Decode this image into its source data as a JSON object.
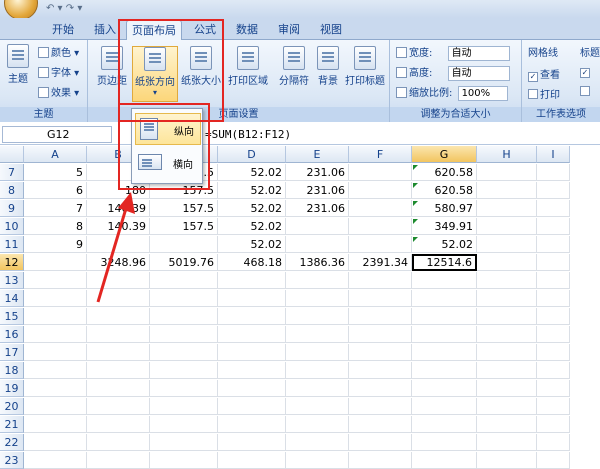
{
  "qat": "↶ ▾ ↷ ▾",
  "tabs": [
    {
      "label": "开始",
      "active": false
    },
    {
      "label": "插入",
      "active": false
    },
    {
      "label": "页面布局",
      "active": true
    },
    {
      "label": "公式",
      "active": false
    },
    {
      "label": "数据",
      "active": false
    },
    {
      "label": "审阅",
      "active": false
    },
    {
      "label": "视图",
      "active": false
    }
  ],
  "ribbon": {
    "theme_group": {
      "label": "主题",
      "theme_button": "主题",
      "colors": "颜色 ▾",
      "fonts": "字体 ▾",
      "effects": "效果 ▾"
    },
    "page_setup": {
      "label": "页面设置",
      "margins": "页边距",
      "orientation": "纸张方向",
      "size": "纸张大小",
      "print_area": "打印区域",
      "breaks": "分隔符",
      "background": "背景",
      "print_titles": "打印标题"
    },
    "scale_group": {
      "label": "调整为合适大小",
      "width_label": "宽度:",
      "width_value": "自动",
      "height_label": "高度:",
      "height_value": "自动",
      "scale_label": "缩放比例:",
      "scale_value": "100%"
    },
    "sheet_options": {
      "label": "工作表选项",
      "gridlines": "网格线",
      "view": "查看",
      "print": "打印",
      "headings": "标题"
    }
  },
  "formula_bar": {
    "name_box": "G12",
    "formula": "=SUM(B12:F12)"
  },
  "columns": [
    "A",
    "B",
    "C",
    "D",
    "E",
    "F",
    "G",
    "H",
    "I"
  ],
  "rows": [
    {
      "num": "7",
      "cells": [
        "5",
        "",
        "157.5",
        "52.02",
        "231.06",
        "",
        "620.58"
      ]
    },
    {
      "num": "8",
      "cells": [
        "6",
        "180",
        "157.5",
        "52.02",
        "231.06",
        "",
        "620.58"
      ]
    },
    {
      "num": "9",
      "cells": [
        "7",
        "140.39",
        "157.5",
        "52.02",
        "231.06",
        "",
        "580.97"
      ]
    },
    {
      "num": "10",
      "cells": [
        "8",
        "140.39",
        "157.5",
        "52.02",
        "",
        "",
        "349.91"
      ]
    },
    {
      "num": "11",
      "cells": [
        "9",
        "",
        "",
        "52.02",
        "",
        "",
        "52.02"
      ]
    },
    {
      "num": "12",
      "cells": [
        "",
        "3248.96",
        "5019.76",
        "468.18",
        "1386.36",
        "2391.34",
        "12514.6"
      ]
    },
    {
      "num": "13",
      "cells": [
        "",
        "",
        "",
        "",
        "",
        "",
        ""
      ]
    },
    {
      "num": "14",
      "cells": [
        "",
        "",
        "",
        "",
        "",
        "",
        ""
      ]
    },
    {
      "num": "15",
      "cells": [
        "",
        "",
        "",
        "",
        "",
        "",
        ""
      ]
    },
    {
      "num": "16",
      "cells": [
        "",
        "",
        "",
        "",
        "",
        "",
        ""
      ]
    },
    {
      "num": "17",
      "cells": [
        "",
        "",
        "",
        "",
        "",
        "",
        ""
      ]
    },
    {
      "num": "18",
      "cells": [
        "",
        "",
        "",
        "",
        "",
        "",
        ""
      ]
    },
    {
      "num": "19",
      "cells": [
        "",
        "",
        "",
        "",
        "",
        "",
        ""
      ]
    },
    {
      "num": "20",
      "cells": [
        "",
        "",
        "",
        "",
        "",
        "",
        ""
      ]
    },
    {
      "num": "21",
      "cells": [
        "",
        "",
        "",
        "",
        "",
        "",
        ""
      ]
    },
    {
      "num": "22",
      "cells": [
        "",
        "",
        "",
        "",
        "",
        "",
        ""
      ]
    },
    {
      "num": "23",
      "cells": [
        "",
        "",
        "",
        "",
        "",
        "",
        ""
      ]
    }
  ],
  "orientation_menu": {
    "portrait": "纵向",
    "landscape": "横向"
  },
  "colors": {
    "annotation": "#e32622",
    "accent_tab": "#15428b"
  }
}
